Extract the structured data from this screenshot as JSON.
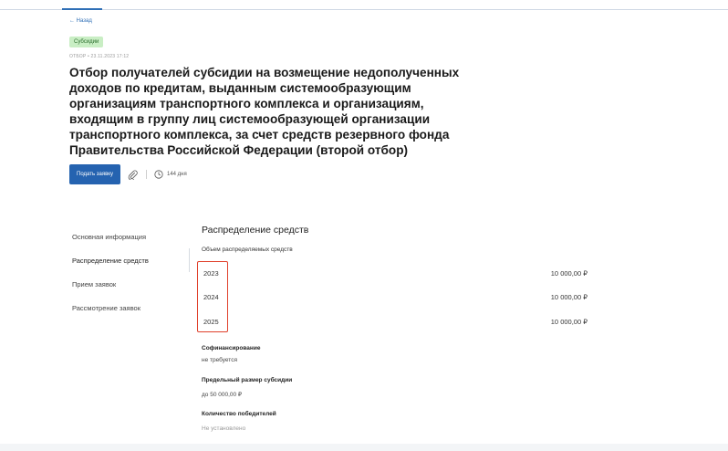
{
  "header": {
    "back_label": "← Назад",
    "badge": "Субсидии",
    "meta": "ОТБОР • 23.11.2023 17:12",
    "title": "Отбор получателей субсидии на возмещение недополученных доходов по кредитам, выданным системообразующим организациям транспортного комплекса и организациям, входящим в группу лиц системообразующей организации транспортного комплекса, за счет средств резервного фонда Правительства Российской Федерации (второй отбор)",
    "apply_button": "Подать заявку",
    "timer": "144 дня"
  },
  "icons": {
    "attachment": "paperclip-icon",
    "timer": "clock-icon"
  },
  "colors": {
    "primary": "#2563b0",
    "badge_bg": "#c9eec4",
    "highlight": "#e0402b"
  },
  "sidebar": {
    "items": [
      {
        "label": "Основная информация"
      },
      {
        "label": "Распределение средств",
        "active": true
      },
      {
        "label": "Прием заявок"
      },
      {
        "label": "Рассмотрение заявок"
      }
    ]
  },
  "main": {
    "heading": "Распределение средств",
    "volume_label": "Объем распределяемых средств",
    "rows": [
      {
        "year": "2023",
        "amount": "10 000,00 ₽"
      },
      {
        "year": "2024",
        "amount": "10 000,00 ₽"
      },
      {
        "year": "2025",
        "amount": "10 000,00 ₽"
      }
    ],
    "cofinancing_label": "Софинансирование",
    "cofinancing_value": "не требуется",
    "max_subsidy_label": "Предельный размер субсидии",
    "max_subsidy_value": "до 50 000,00 ₽",
    "winners_label": "Количество победителей",
    "winners_value": "Не установлено"
  }
}
